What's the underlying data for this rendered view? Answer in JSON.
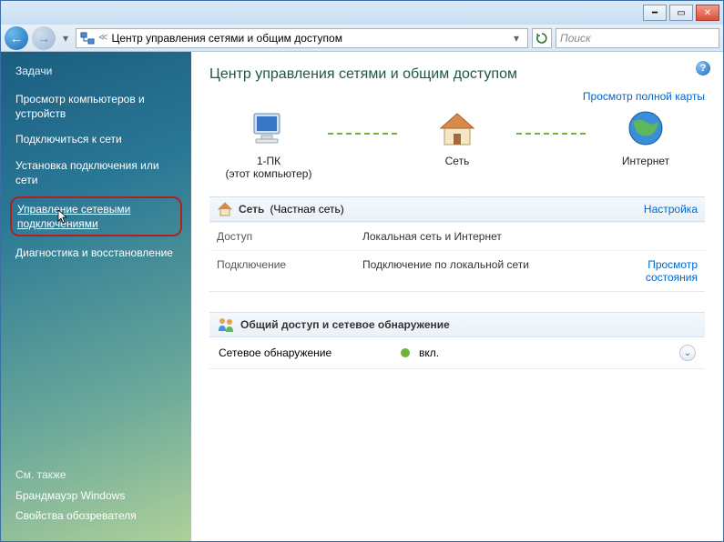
{
  "addrbar": {
    "path": "Центр управления сетями и общим доступом",
    "search_placeholder": "Поиск"
  },
  "sidebar": {
    "tasks_header": "Задачи",
    "tasks": [
      "Просмотр компьютеров и устройств",
      "Подключиться к сети",
      "Установка подключения или сети",
      "Управление сетевыми подключениями",
      "Диагностика и восстановление"
    ],
    "see_also_header": "См. также",
    "see_also": [
      "Брандмауэр Windows",
      "Свойства обозревателя"
    ]
  },
  "content": {
    "title": "Центр управления сетями и общим доступом",
    "full_map_link": "Просмотр полной карты",
    "nodes": {
      "pc_name": "1-ПК",
      "pc_sub": "(этот компьютер)",
      "net_name": "Сеть",
      "internet_name": "Интернет"
    },
    "network_section": {
      "name": "Сеть",
      "type": "(Частная сеть)",
      "customize_link": "Настройка",
      "access_label": "Доступ",
      "access_value": "Локальная сеть и Интернет",
      "conn_label": "Подключение",
      "conn_value": "Подключение по локальной сети",
      "status_link": "Просмотр состояния"
    },
    "sharing_section": {
      "title": "Общий доступ и сетевое обнаружение",
      "discovery_label": "Сетевое обнаружение",
      "discovery_value": "вкл."
    }
  }
}
